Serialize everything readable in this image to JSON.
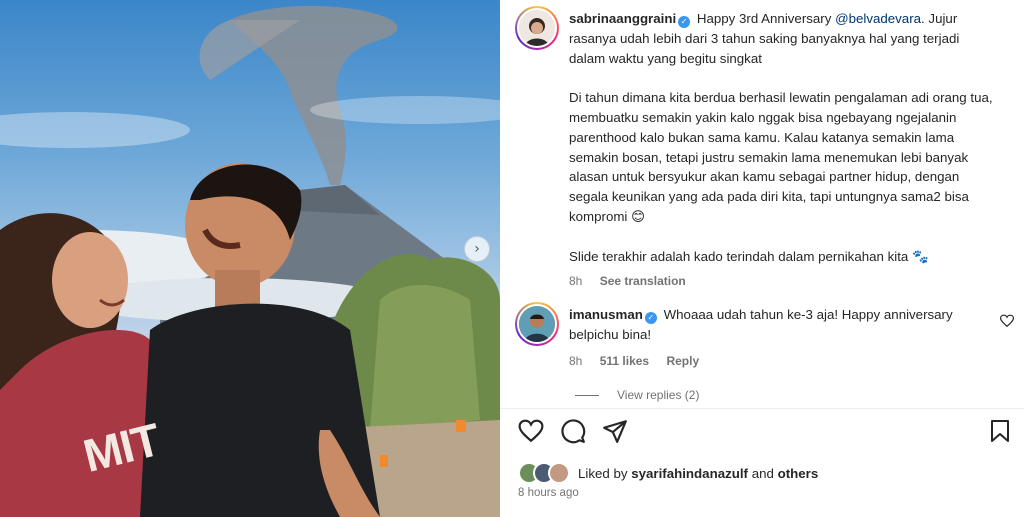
{
  "post": {
    "author": "sabrinaanggraini",
    "caption_intro": "Happy 3rd Anniversary",
    "mention": "@belvadevara",
    "caption_p1_rest": ". Jujur rasanya udah lebih dari 3 tahun saking banyaknya hal yang terjadi dalam waktu yang begitu singkat",
    "caption_p2": "Di tahun dimana kita berdua berhasil lewatin pengalaman adi orang tua, membuatku semakin yakin kalo nggak bisa ngebayang ngejalanin parenthood kalo bukan sama kamu. Kalau katanya semakin lama semakin bosan, tetapi justru semakin lama menemukan lebi banyak alasan untuk bersyukur akan kamu sebagai partner hidup, dengan segala keunikan yang ada pada diri kita, tapi untungnya sama2 bisa kompromi 😊",
    "caption_p3": "Slide terakhir adalah kado terindah dalam pernikahan kita 🐾",
    "caption_time": "8h",
    "see_translation": "See translation"
  },
  "comment": {
    "author": "imanusman",
    "text": "Whoaaa udah tahun ke-3 aja! Happy anniversary belpichu bina!",
    "time": "8h",
    "likes": "511 likes",
    "reply": "Reply",
    "view_replies": "View replies (2)"
  },
  "engagement": {
    "liked_by_prefix": "Liked by",
    "liked_by_user": "syarifahindanazulf",
    "liked_by_and": "and",
    "liked_by_others": "others",
    "posted_ago": "8 hours ago"
  },
  "photo": {
    "shirt_text": "MIT"
  },
  "icons": {
    "verified": "verified-badge-icon",
    "like": "heart-icon",
    "comment": "comment-icon",
    "share": "paper-plane-icon",
    "save": "bookmark-icon",
    "carousel_next": "chevron-right-icon"
  },
  "colors": {
    "verified": "#3897f0",
    "mention": "#00376b",
    "muted": "#737373",
    "text": "#262626"
  }
}
